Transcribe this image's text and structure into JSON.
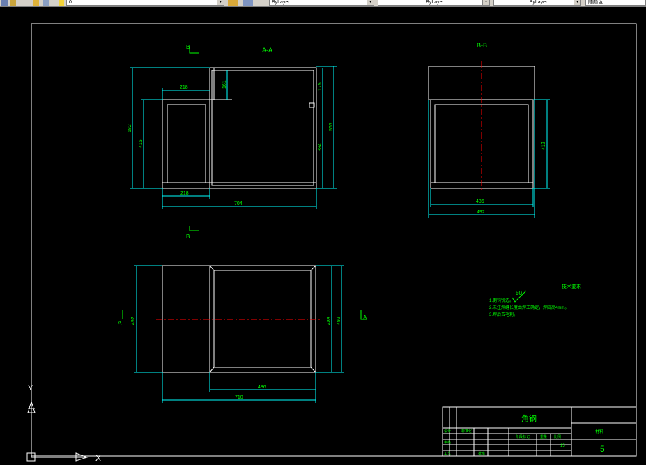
{
  "toolbar": {
    "layer_value": "0",
    "color_value": "ByLayer",
    "linetype_value": "ByLayer",
    "lineweight_value": "ByLayer",
    "plotstyle_value": "随颜色"
  },
  "drawing": {
    "view_aa_title": "A-A",
    "view_bb_title": "B-B",
    "section_mark_b": "B",
    "section_mark_a": "A",
    "aa_dims": {
      "top_width": "218",
      "notch_height": "161",
      "right_upper": "175",
      "total_height": "582",
      "left_height": "415",
      "right_total": "565",
      "right_lower": "394",
      "bottom_inner": "218",
      "bottom_total": "704"
    },
    "bb_dims": {
      "height": "412",
      "inner_width": "486",
      "outer_width": "492"
    },
    "plan_dims": {
      "left_height": "492",
      "inner_height": "488",
      "right_height": "492",
      "inner_width": "486",
      "total_width": "710"
    },
    "notes": {
      "roughness": "50",
      "heading": "技术要求",
      "line1": "1.倒钝锐边。",
      "line2": "2.未注焊缝长度由焊工确定，焊脚高4mm。",
      "line3": "3.焊后去毛刺。"
    },
    "title_block": {
      "part_name": "角钢",
      "material_label": "材料",
      "sheet_number": "5",
      "scale": "15",
      "label_drawn": "设计",
      "label_checked": "审核",
      "label_standard": "标准化",
      "label_process": "工艺",
      "label_approved": "批准",
      "label_stage": "阶段标记",
      "label_weight": "重量",
      "label_ratio": "比例"
    },
    "ucs": {
      "y_label": "Y",
      "x_label": "X"
    }
  },
  "colors": {
    "background": "#000000",
    "geometry": "#ffffff",
    "dimension": "#00ffff",
    "text": "#00ff00",
    "centerline": "#ff0000"
  }
}
